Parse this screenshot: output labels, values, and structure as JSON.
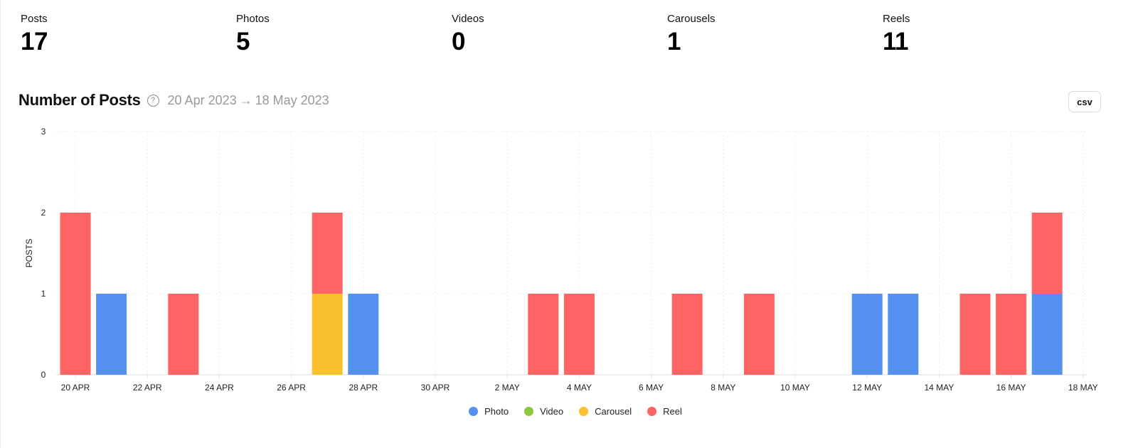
{
  "stats": [
    {
      "label": "Posts",
      "value": "17"
    },
    {
      "label": "Photos",
      "value": "5"
    },
    {
      "label": "Videos",
      "value": "0"
    },
    {
      "label": "Carousels",
      "value": "1"
    },
    {
      "label": "Reels",
      "value": "11"
    }
  ],
  "chart_header": {
    "title": "Number of Posts",
    "help_icon": "question-circle-icon",
    "help_glyph": "?",
    "date_start": "20 Apr 2023",
    "arrow": "→",
    "date_end": "18 May 2023",
    "csv_label": "csv"
  },
  "colors": {
    "Photo": "#5591F0",
    "Video": "#8DC63F",
    "Carousel": "#FBC02D",
    "Reel": "#FF6464"
  },
  "chart_data": {
    "type": "bar",
    "stacked": true,
    "title": "Number of Posts",
    "xlabel": "",
    "ylabel": "POSTS",
    "ylim": [
      0,
      3
    ],
    "yticks": [
      0,
      1,
      2,
      3
    ],
    "grid": true,
    "legend_position": "bottom",
    "x_domain": [
      "2023-04-20",
      "2023-05-18"
    ],
    "xtick_labels": [
      "20 APR",
      "22 APR",
      "24 APR",
      "26 APR",
      "28 APR",
      "30 APR",
      "2 MAY",
      "4 MAY",
      "6 MAY",
      "8 MAY",
      "10 MAY",
      "12 MAY",
      "14 MAY",
      "16 MAY",
      "18 MAY"
    ],
    "categories": [
      "20 Apr",
      "21 Apr",
      "23 Apr",
      "27 Apr",
      "28 Apr",
      "3 May",
      "4 May",
      "7 May",
      "9 May",
      "12 May",
      "13 May",
      "15 May",
      "16 May",
      "17 May"
    ],
    "day_offsets": [
      0,
      1,
      3,
      7,
      8,
      13,
      14,
      17,
      19,
      22,
      23,
      25,
      26,
      27
    ],
    "series": [
      {
        "name": "Photo",
        "values": [
          0,
          1,
          0,
          0,
          1,
          0,
          0,
          0,
          0,
          1,
          1,
          0,
          0,
          1
        ]
      },
      {
        "name": "Video",
        "values": [
          0,
          0,
          0,
          0,
          0,
          0,
          0,
          0,
          0,
          0,
          0,
          0,
          0,
          0
        ]
      },
      {
        "name": "Carousel",
        "values": [
          0,
          0,
          0,
          1,
          0,
          0,
          0,
          0,
          0,
          0,
          0,
          0,
          0,
          0
        ]
      },
      {
        "name": "Reel",
        "values": [
          2,
          0,
          1,
          1,
          0,
          1,
          1,
          1,
          1,
          0,
          0,
          1,
          1,
          1
        ]
      }
    ]
  },
  "legend": [
    {
      "label": "Photo"
    },
    {
      "label": "Video"
    },
    {
      "label": "Carousel"
    },
    {
      "label": "Reel"
    }
  ]
}
